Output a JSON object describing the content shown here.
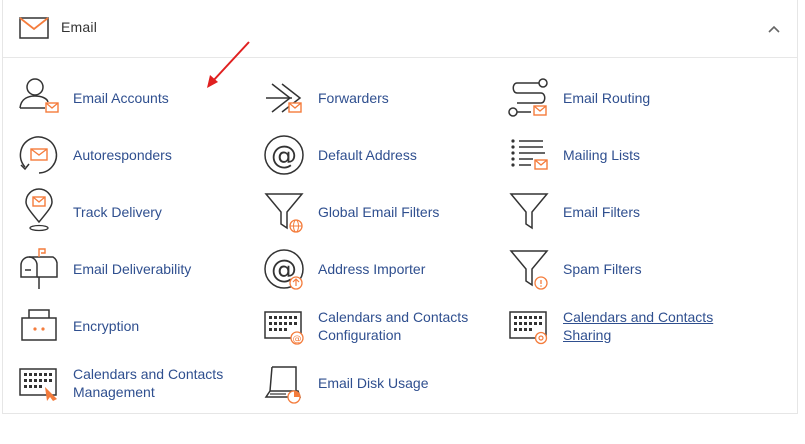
{
  "section": {
    "title": "Email",
    "icon": "envelope-icon",
    "collapse_icon": "chevron-up-icon"
  },
  "accent_color": "#f47c3c",
  "label_color": "#2f4f8f",
  "annotation": {
    "icon": "red-arrow-icon",
    "color": "#e02020"
  },
  "items": [
    {
      "label": "Email Accounts",
      "icon": "email-accounts-icon"
    },
    {
      "label": "Forwarders",
      "icon": "forwarders-icon"
    },
    {
      "label": "Email Routing",
      "icon": "email-routing-icon"
    },
    {
      "label": "Autoresponders",
      "icon": "autoresponders-icon"
    },
    {
      "label": "Default Address",
      "icon": "default-address-icon"
    },
    {
      "label": "Mailing Lists",
      "icon": "mailing-lists-icon"
    },
    {
      "label": "Track Delivery",
      "icon": "track-delivery-icon"
    },
    {
      "label": "Global Email Filters",
      "icon": "global-email-filters-icon"
    },
    {
      "label": "Email Filters",
      "icon": "email-filters-icon"
    },
    {
      "label": "Email Deliverability",
      "icon": "email-deliverability-icon"
    },
    {
      "label": "Address Importer",
      "icon": "address-importer-icon"
    },
    {
      "label": "Spam Filters",
      "icon": "spam-filters-icon"
    },
    {
      "label": "Encryption",
      "icon": "encryption-icon"
    },
    {
      "label_line1": "Calendars and Contacts",
      "label_line2": "Configuration",
      "icon": "calendars-contacts-configuration-icon"
    },
    {
      "label_line1": "Calendars and Contacts",
      "label_line2": "Sharing",
      "icon": "calendars-contacts-sharing-icon"
    },
    {
      "label_line1": "Calendars and Contacts",
      "label_line2": "Management",
      "icon": "calendars-contacts-management-icon"
    },
    {
      "label": "Email Disk Usage",
      "icon": "email-disk-usage-icon"
    }
  ]
}
